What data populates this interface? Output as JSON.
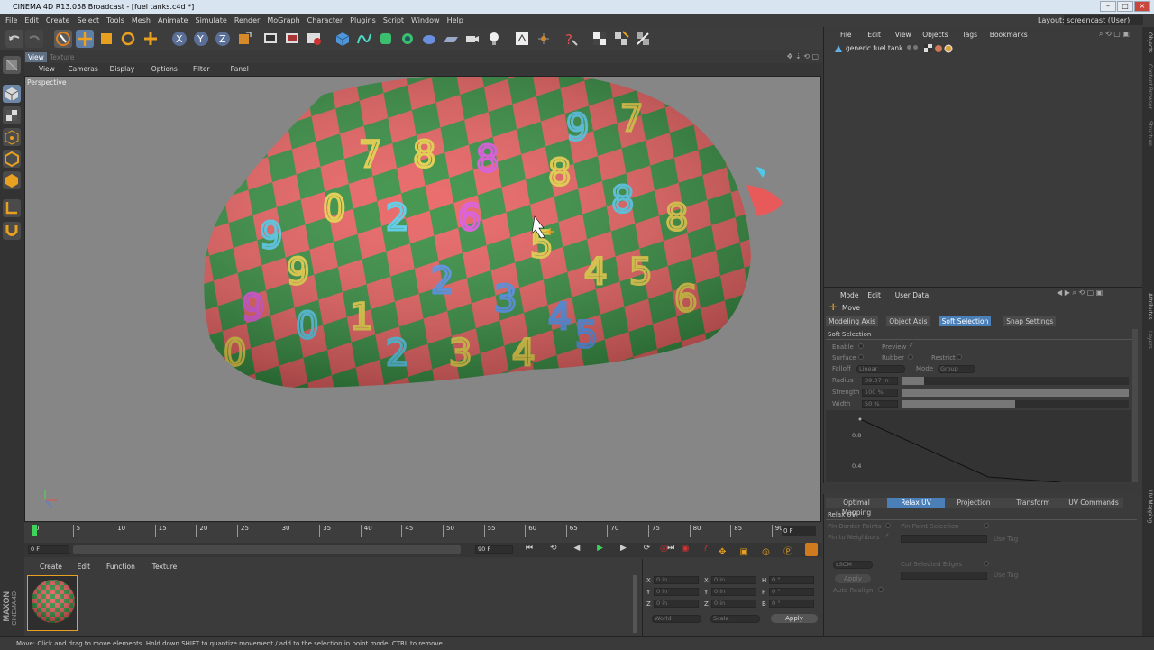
{
  "window": {
    "title": "CINEMA 4D R13.058 Broadcast - [fuel tanks.c4d *]"
  },
  "menu": [
    "File",
    "Edit",
    "Create",
    "Select",
    "Tools",
    "Mesh",
    "Animate",
    "Simulate",
    "Render",
    "MoGraph",
    "Character",
    "Plugins",
    "Script",
    "Window",
    "Help"
  ],
  "layout": {
    "label": "Layout:",
    "value": "screencast (User)"
  },
  "view_tabs": {
    "view": "View",
    "texture": "Texture"
  },
  "view_menu": [
    "View",
    "Cameras",
    "Display",
    "Options",
    "Filter",
    "Panel"
  ],
  "viewport": {
    "label": "Perspective"
  },
  "object_manager": {
    "menu": [
      "File",
      "Edit",
      "View",
      "Objects",
      "Tags",
      "Bookmarks"
    ],
    "objects": [
      {
        "name": "generic fuel tank"
      }
    ]
  },
  "attribute_manager": {
    "menu": [
      "Mode",
      "Edit",
      "User Data"
    ],
    "tool_name": "Move",
    "tabs": [
      "Modeling Axis",
      "Object Axis",
      "Soft Selection",
      "Snap Settings"
    ],
    "active_tab": "Soft Selection",
    "section": "Soft Selection",
    "enable": "Enable",
    "preview": "Preview",
    "surface": "Surface",
    "rubber": "Rubber",
    "restrict": "Restrict",
    "falloff": "Falloff",
    "falloff_value": "Linear",
    "mode": "Mode",
    "mode_value": "Group",
    "radius": "Radius",
    "radius_value": "39.37 in",
    "radius_fill": 0.1,
    "strength": "Strength",
    "strength_value": "100 %",
    "strength_fill": 1.0,
    "width": "Width",
    "width_value": "50 %",
    "width_fill": 0.5,
    "graph_ticks": [
      "0.8",
      "0.4"
    ]
  },
  "uv_panel": {
    "tabs": [
      "Optimal Mapping",
      "Relax UV",
      "Projection",
      "Transform",
      "UV Commands"
    ],
    "active_tab": "Relax UV",
    "section": "Relax UV",
    "pin_border": "Pin Border Points",
    "pin_neighbors": "Pin to Neighbors",
    "pin_point_selection": "Pin Point Selection",
    "use_tag_1": "Use Tag",
    "lscm": "LSCM",
    "apply": "Apply",
    "cut_edges": "Cut Selected Edges",
    "use_tag_2": "Use Tag",
    "auto_realign": "Auto Realign"
  },
  "timeline": {
    "ticks": [
      "0",
      "5",
      "10",
      "15",
      "20",
      "25",
      "30",
      "35",
      "40",
      "45",
      "50",
      "55",
      "60",
      "65",
      "70",
      "75",
      "80",
      "85",
      "90"
    ],
    "end_frame": "0 F",
    "current": "0 F",
    "start_field": "0 F",
    "end_field": "90 F",
    "range_end": "90 F"
  },
  "material_manager": {
    "menu": [
      "Create",
      "Edit",
      "Function",
      "Texture"
    ],
    "brand1": "MAXON",
    "brand2": "CINEMA 4D"
  },
  "coordinates": {
    "rows": [
      {
        "a": "X",
        "av": "0 in",
        "b": "X",
        "bv": "0 in",
        "c": "H",
        "cv": "0 °"
      },
      {
        "a": "Y",
        "av": "0 in",
        "b": "Y",
        "bv": "0 in",
        "c": "P",
        "cv": "0 °"
      },
      {
        "a": "Z",
        "av": "0 in",
        "b": "Z",
        "bv": "0 in",
        "c": "B",
        "cv": "0 °"
      }
    ],
    "world": "World",
    "scale": "Scale",
    "apply": "Apply"
  },
  "status": "Move: Click and drag to move elements. Hold down SHIFT to quantize movement / add to the selection in point mode, CTRL to remove.",
  "side_tabs": [
    "Objects",
    "Content Browser",
    "Structure",
    "Attributes",
    "Layers",
    "UV Mapping"
  ],
  "colors": {
    "accent": "#4a7fb8",
    "tex_red": "#e85a5a",
    "tex_green": "#2e8a3a"
  }
}
